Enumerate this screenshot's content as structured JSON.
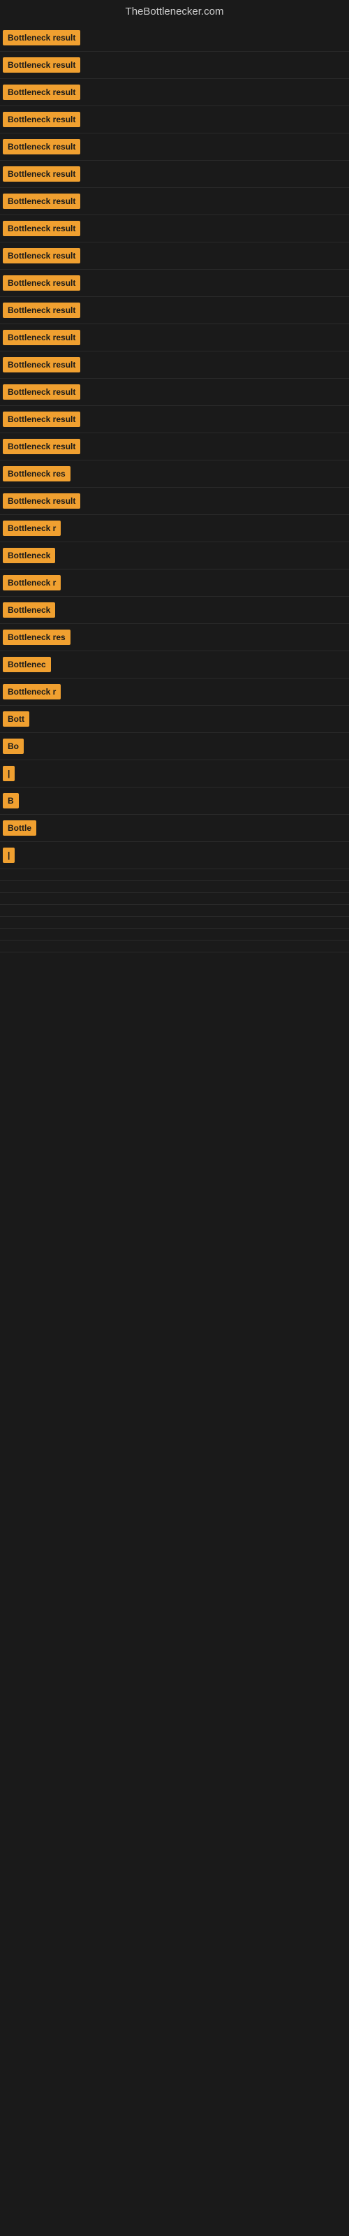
{
  "site_title": "TheBottlenecker.com",
  "rows": [
    {
      "label": "Bottleneck result",
      "badge_width": 115
    },
    {
      "label": "Bottleneck result",
      "badge_width": 115
    },
    {
      "label": "Bottleneck result",
      "badge_width": 115
    },
    {
      "label": "Bottleneck result",
      "badge_width": 115
    },
    {
      "label": "Bottleneck result",
      "badge_width": 115
    },
    {
      "label": "Bottleneck result",
      "badge_width": 115
    },
    {
      "label": "Bottleneck result",
      "badge_width": 115
    },
    {
      "label": "Bottleneck result",
      "badge_width": 115
    },
    {
      "label": "Bottleneck result",
      "badge_width": 115
    },
    {
      "label": "Bottleneck result",
      "badge_width": 115
    },
    {
      "label": "Bottleneck result",
      "badge_width": 115
    },
    {
      "label": "Bottleneck result",
      "badge_width": 115
    },
    {
      "label": "Bottleneck result",
      "badge_width": 115
    },
    {
      "label": "Bottleneck result",
      "badge_width": 115
    },
    {
      "label": "Bottleneck result",
      "badge_width": 115
    },
    {
      "label": "Bottleneck result",
      "badge_width": 115
    },
    {
      "label": "Bottleneck res",
      "badge_width": 96
    },
    {
      "label": "Bottleneck result",
      "badge_width": 115
    },
    {
      "label": "Bottleneck r",
      "badge_width": 80
    },
    {
      "label": "Bottleneck",
      "badge_width": 72
    },
    {
      "label": "Bottleneck r",
      "badge_width": 80
    },
    {
      "label": "Bottleneck",
      "badge_width": 72
    },
    {
      "label": "Bottleneck res",
      "badge_width": 96
    },
    {
      "label": "Bottlenec",
      "badge_width": 65
    },
    {
      "label": "Bottleneck r",
      "badge_width": 80
    },
    {
      "label": "Bott",
      "badge_width": 36
    },
    {
      "label": "Bo",
      "badge_width": 24
    },
    {
      "label": "|",
      "badge_width": 10
    },
    {
      "label": "B",
      "badge_width": 16
    },
    {
      "label": "Bottle",
      "badge_width": 45
    },
    {
      "label": "|",
      "badge_width": 10
    },
    {
      "label": "",
      "badge_width": 0
    },
    {
      "label": "",
      "badge_width": 0
    },
    {
      "label": "",
      "badge_width": 0
    },
    {
      "label": "",
      "badge_width": 0
    },
    {
      "label": "",
      "badge_width": 0
    },
    {
      "label": "",
      "badge_width": 0
    },
    {
      "label": "",
      "badge_width": 0
    }
  ]
}
